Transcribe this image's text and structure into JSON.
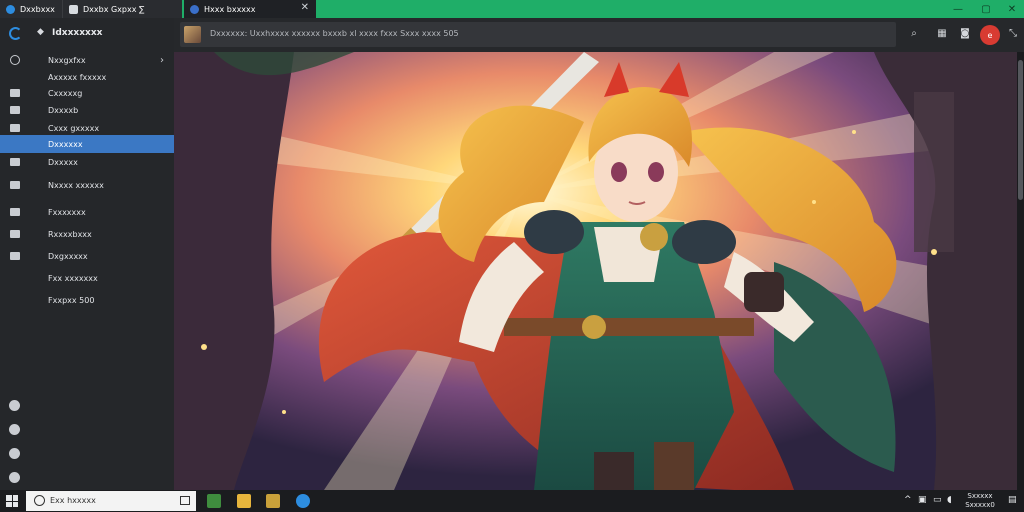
{
  "tabs": [
    {
      "label": "Dxxbxxx"
    },
    {
      "label": "Dxxbx Gxpxx ∑"
    },
    {
      "label": "Hxxx bxxxxx"
    }
  ],
  "sidebar": {
    "title": "Idxxxxxxx",
    "items": [
      {
        "label": "Nxxgxfxx"
      },
      {
        "label": "Axxxxx fxxxxx"
      },
      {
        "label": "Cxxxxxg"
      },
      {
        "label": "Dxxxxb"
      },
      {
        "label": "Cxxx gxxxxx"
      },
      {
        "label": "Dxxxxxx"
      },
      {
        "label": "Dxxxxx"
      },
      {
        "label": "Nxxxx xxxxxx"
      },
      {
        "label": "Fxxxxxxx"
      },
      {
        "label": "Rxxxxbxxx"
      },
      {
        "label": "Dxgxxxxx"
      },
      {
        "label": "Fxx xxxxxxx"
      },
      {
        "label": "Fxxpxx 500"
      }
    ]
  },
  "addressbar": {
    "url": "Dxxxxxx: Uxxhxxxx xxxxxx bxxxb xl xxxx fxxx Sxxx xxxx 505"
  },
  "rec_button": {
    "label": "e"
  },
  "taskbar": {
    "search_placeholder": "Exx hxxxxx",
    "clock_time": "Sxxxxx",
    "clock_date": "Sxxxxx0"
  },
  "colors": {
    "titlebar": "#1fae68",
    "active_nav": "#3b78c4",
    "record": "#d83b32"
  },
  "icons": {
    "browser": "edge-icon",
    "artwork": "anime-swordswoman-illustration"
  }
}
